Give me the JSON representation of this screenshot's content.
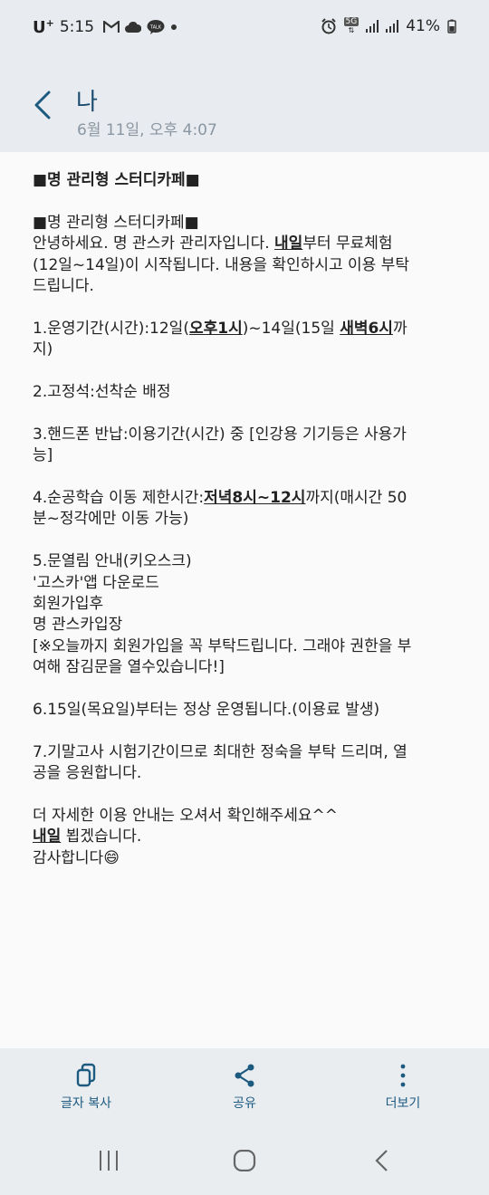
{
  "status_bar": {
    "carrier": "U",
    "time": "5:15",
    "network_label": "5G",
    "battery_pct": "41%"
  },
  "header": {
    "title": "나",
    "timestamp": "6월 11일, 오후 4:07"
  },
  "message": {
    "lines": [
      [
        {
          "t": "■명 관리형 스터디카페■",
          "s": "title"
        }
      ],
      [],
      [
        {
          "t": "■명 관리형 스터디카페■"
        }
      ],
      [
        {
          "t": "안녕하세요. 명 관스카 관리자입니다. "
        },
        {
          "t": "내일",
          "s": "hl"
        },
        {
          "t": "부터 무료체험"
        }
      ],
      [
        {
          "t": "(12일~14일)이 시작됩니다. 내용을 확인하시고 이용 부탁"
        }
      ],
      [
        {
          "t": "드립니다."
        }
      ],
      [],
      [
        {
          "t": "1.운영기간(시간):12일("
        },
        {
          "t": "오후1시",
          "s": "hl"
        },
        {
          "t": ")~14일(15일 "
        },
        {
          "t": "새벽6시",
          "s": "hl"
        },
        {
          "t": "까"
        }
      ],
      [
        {
          "t": "지)"
        }
      ],
      [],
      [
        {
          "t": "2.고정석:선착순 배정"
        }
      ],
      [],
      [
        {
          "t": "3.핸드폰 반납:이용기간(시간) 중 [인강용 기기등은 사용가"
        }
      ],
      [
        {
          "t": "능]"
        }
      ],
      [],
      [
        {
          "t": "4.순공학습 이동 제한시간:"
        },
        {
          "t": "저녁8시~12시",
          "s": "hl"
        },
        {
          "t": "까지(매시간 50"
        }
      ],
      [
        {
          "t": "분~정각에만 이동 가능)"
        }
      ],
      [],
      [
        {
          "t": "5.문열림 안내(키오스크)"
        }
      ],
      [
        {
          "t": "'고스카'앱 다운로드"
        }
      ],
      [
        {
          "t": "회원가입후"
        }
      ],
      [
        {
          "t": "명 관스카입장"
        }
      ],
      [
        {
          "t": "[※오늘까지 회원가입을 꼭 부탁드립니다. 그래야 권한을 부"
        }
      ],
      [
        {
          "t": "여해 잠김문을 열수있습니다!]"
        }
      ],
      [],
      [
        {
          "t": "6.15일(목요일)부터는 정상 운영됩니다.(이용료 발생)"
        }
      ],
      [],
      [
        {
          "t": "7.기말고사 시험기간이므로 최대한 정숙을 부탁 드리며, 열"
        }
      ],
      [
        {
          "t": "공을 응원합니다."
        }
      ],
      [],
      [
        {
          "t": "더 자세한 이용 안내는 오셔서 확인해주세요^^"
        }
      ],
      [
        {
          "t": "내일",
          "s": "hl"
        },
        {
          "t": " 뵙겠습니다."
        }
      ],
      [
        {
          "t": "감사합니다😄"
        }
      ]
    ]
  },
  "actions": {
    "copy_label": "글자 복사",
    "share_label": "공유",
    "more_label": "더보기"
  },
  "colors": {
    "accent": "#1c5a80",
    "header_bg": "#e8ebef"
  }
}
